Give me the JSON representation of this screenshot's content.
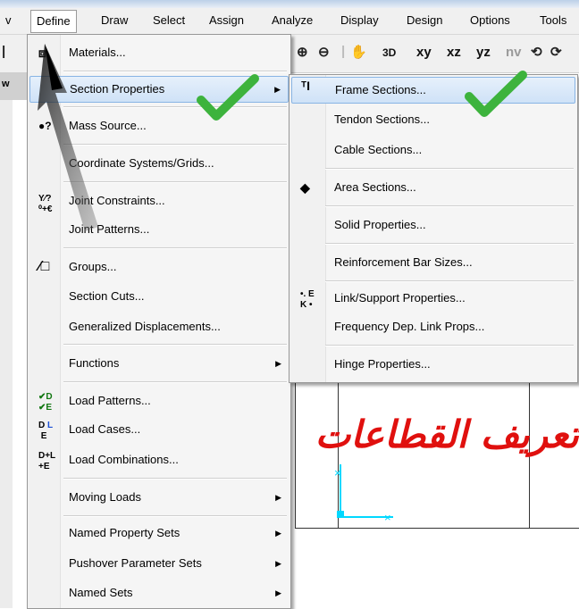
{
  "menubar": {
    "items": [
      "v",
      "Define",
      "Draw",
      "Select",
      "Assign",
      "Analyze",
      "Display",
      "Design",
      "Options",
      "Tools"
    ]
  },
  "toolbar": {
    "view_xy": "xy",
    "view_xz": "xz",
    "view_yz": "yz",
    "view_nv": "nv",
    "view_3d": "3D",
    "zoom_in_icon": "zoom-in-icon",
    "zoom_out_icon": "zoom-out-icon",
    "pan_icon": "pan-icon"
  },
  "workspace": {
    "window_label": "w"
  },
  "define_menu": {
    "items": [
      {
        "label": "Materials...",
        "icon": "materials-icon",
        "submenu": false
      },
      {
        "label": "Section Properties",
        "icon": "",
        "submenu": true
      },
      {
        "label": "Mass Source...",
        "icon": "mass-source-icon",
        "submenu": false
      },
      {
        "label": "Coordinate Systems/Grids...",
        "icon": "",
        "submenu": false
      },
      {
        "label": "Joint Constraints...",
        "icon": "joint-constraints-icon",
        "submenu": false
      },
      {
        "label": "Joint Patterns...",
        "icon": "",
        "submenu": false
      },
      {
        "label": "Groups...",
        "icon": "groups-icon",
        "submenu": false
      },
      {
        "label": "Section Cuts...",
        "icon": "",
        "submenu": false
      },
      {
        "label": "Generalized Displacements...",
        "icon": "",
        "submenu": false
      },
      {
        "label": "Functions",
        "icon": "",
        "submenu": true
      },
      {
        "label": "Load Patterns...",
        "icon": "load-patterns-icon",
        "submenu": false
      },
      {
        "label": "Load Cases...",
        "icon": "load-cases-icon",
        "submenu": false
      },
      {
        "label": "Load Combinations...",
        "icon": "load-combinations-icon",
        "submenu": false
      },
      {
        "label": "Moving Loads",
        "icon": "",
        "submenu": true
      },
      {
        "label": "Named Property Sets",
        "icon": "",
        "submenu": true
      },
      {
        "label": "Pushover Parameter Sets",
        "icon": "",
        "submenu": true
      },
      {
        "label": "Named Sets",
        "icon": "",
        "submenu": true
      }
    ]
  },
  "section_properties_menu": {
    "items": [
      {
        "label": "Frame Sections...",
        "icon": "frame-sections-icon"
      },
      {
        "label": "Tendon Sections...",
        "icon": ""
      },
      {
        "label": "Cable Sections...",
        "icon": ""
      },
      {
        "label": "Area Sections...",
        "icon": "area-sections-icon"
      },
      {
        "label": "Solid Properties...",
        "icon": ""
      },
      {
        "label": "Reinforcement Bar Sizes...",
        "icon": ""
      },
      {
        "label": "Link/Support Properties...",
        "icon": "link-support-icon"
      },
      {
        "label": "Frequency Dep. Link Props...",
        "icon": ""
      },
      {
        "label": "Hinge Properties...",
        "icon": ""
      }
    ]
  },
  "icon_glyphs": {
    "load_patterns": "✔D ✔E",
    "load_cases": "D L E",
    "load_combinations": "D+L +E",
    "link_support": "K E",
    "groups": "⁄□",
    "frame": "T I"
  },
  "annotation": {
    "arabic_caption": "تعريف القطاعات",
    "caption_color": "#e0100e",
    "checkmark_color": "#3db33d"
  }
}
